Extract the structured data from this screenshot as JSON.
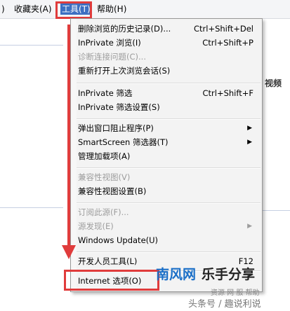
{
  "menubar": {
    "left_fragment": ")",
    "favorites": "收藏夹(A)",
    "tools": "工具(T)",
    "help": "帮助(H)"
  },
  "background": {
    "right_link": "视频"
  },
  "menu": {
    "g1": [
      {
        "label": "删除浏览的历史记录(D)...",
        "shortcut": "Ctrl+Shift+Del",
        "disabled": false
      },
      {
        "label": "InPrivate 浏览(I)",
        "shortcut": "Ctrl+Shift+P",
        "disabled": false
      },
      {
        "label": "诊断连接问题(C)...",
        "shortcut": "",
        "disabled": true
      },
      {
        "label": "重新打开上次浏览会话(S)",
        "shortcut": "",
        "disabled": false
      }
    ],
    "g2": [
      {
        "label": "InPrivate 筛选",
        "shortcut": "Ctrl+Shift+F",
        "disabled": false
      },
      {
        "label": "InPrivate 筛选设置(S)",
        "shortcut": "",
        "disabled": false
      }
    ],
    "g3": [
      {
        "label": "弹出窗口阻止程序(P)",
        "submenu": true,
        "disabled": false
      },
      {
        "label": "SmartScreen 筛选器(T)",
        "submenu": true,
        "disabled": false
      },
      {
        "label": "管理加载项(A)",
        "submenu": false,
        "disabled": false
      }
    ],
    "g4": [
      {
        "label": "兼容性视图(V)",
        "disabled": true
      },
      {
        "label": "兼容性视图设置(B)",
        "disabled": false
      }
    ],
    "g5": [
      {
        "label": "订阅此源(F)...",
        "submenu": false,
        "disabled": true
      },
      {
        "label": "源发现(E)",
        "submenu": true,
        "disabled": true
      },
      {
        "label": "Windows Update(U)",
        "submenu": false,
        "disabled": false
      }
    ],
    "g6": [
      {
        "label": "开发人员工具(L)",
        "shortcut": "F12",
        "disabled": false
      }
    ],
    "g7": [
      {
        "label": "Internet 选项(O)",
        "disabled": false
      }
    ],
    "submenu_arrow": "▶"
  },
  "watermark": {
    "brand": "南风网",
    "slogan": "乐手分享",
    "small": "资源 网 服 帮助",
    "bottom": "头条号 / 趣说利说"
  },
  "colors": {
    "annotation_red": "#e03c3c",
    "highlight_blue": "#3c6fc2",
    "watermark_blue": "#1b6fc7"
  }
}
